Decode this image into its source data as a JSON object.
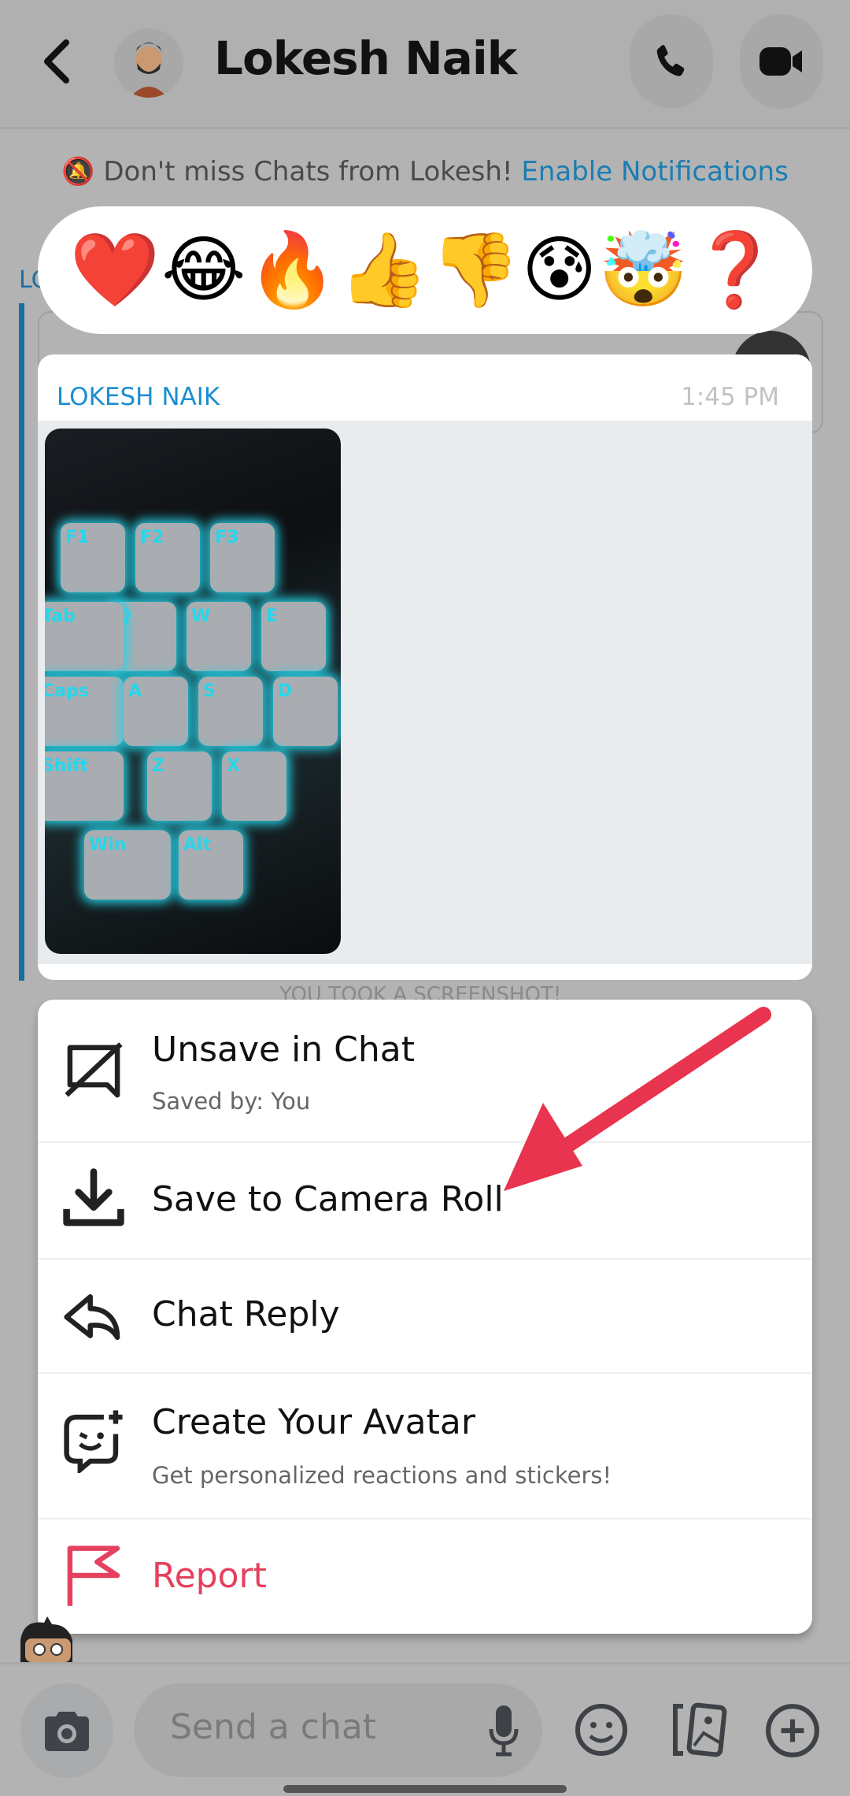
{
  "header": {
    "title": "Lokesh Naik",
    "back_icon": "chevron-left-icon",
    "call_icon": "phone-icon",
    "video_icon": "video-camera-icon"
  },
  "notice": {
    "text": "Don't miss Chats from Lokesh!",
    "link": "Enable Notifications",
    "icon": "bell-off-icon"
  },
  "background": {
    "partial_sender": "LO",
    "partial_status": "YOU TOOK A SCREENSHOT!"
  },
  "reactions": [
    "❤️",
    "😂",
    "🔥",
    "👍",
    "👎",
    "😰",
    "🤯",
    "❓"
  ],
  "message": {
    "sender": "LOKESH NAIK",
    "time": "1:45 PM",
    "keys": [
      "F1",
      "F2",
      "F3",
      "Q",
      "W",
      "E",
      "Tab",
      "Caps",
      "A",
      "S",
      "D",
      "Shift",
      "Z",
      "X",
      "Win",
      "Alt"
    ]
  },
  "menu": {
    "items": [
      {
        "label": "Unsave in Chat",
        "sub": "Saved by: You",
        "icon": "unsave-chat-icon"
      },
      {
        "label": "Save to Camera Roll",
        "icon": "download-icon"
      },
      {
        "label": "Chat Reply",
        "icon": "reply-icon"
      },
      {
        "label": "Create Your Avatar",
        "sub": "Get personalized reactions and stickers!",
        "icon": "avatar-add-icon"
      },
      {
        "label": "Report",
        "icon": "flag-icon"
      }
    ],
    "report_color": "#e5405e"
  },
  "annotation": {
    "arrow_color": "#e8344e"
  },
  "composer": {
    "placeholder": "Send a chat",
    "camera_icon": "camera-icon",
    "mic_icon": "microphone-icon",
    "emoji_icon": "smiley-icon",
    "memories_icon": "cards-icon",
    "plus_icon": "plus-icon"
  }
}
